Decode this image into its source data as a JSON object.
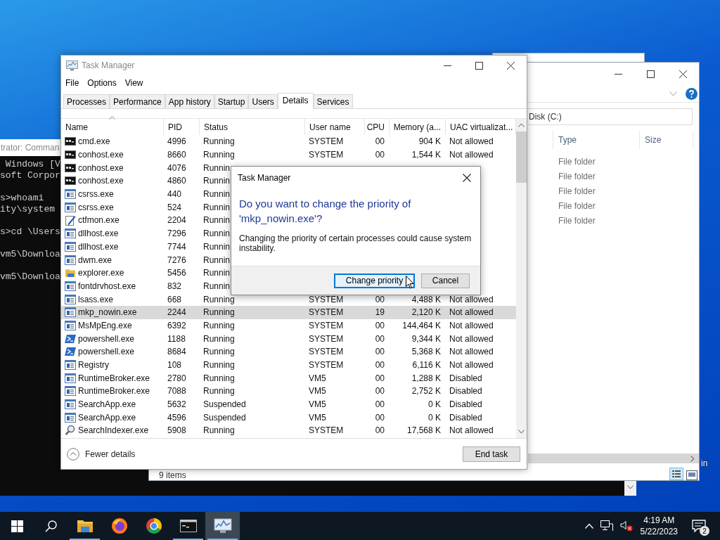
{
  "desktop": {
    "icon_labels": [
      "in"
    ]
  },
  "console_window": {
    "title": "trator: Comman",
    "blocks": [
      [
        " Windows [V",
        "soft Corpor"
      ],
      [
        "s>whoami",
        "ity\\system"
      ],
      [
        "s>cd \\Users"
      ],
      [
        "vm5\\Downloa"
      ],
      [
        "vm5\\Downloa"
      ]
    ]
  },
  "explorer_window": {
    "address": "Disk (C:)",
    "columns": [
      "Type",
      "Size"
    ],
    "rows": [
      {
        "type": "File folder"
      },
      {
        "type": "File folder"
      },
      {
        "type": "File folder"
      },
      {
        "type": "File folder"
      },
      {
        "type": "File folder"
      }
    ],
    "status": "9 items"
  },
  "task_manager": {
    "title": "Task Manager",
    "menu": [
      "File",
      "Options",
      "View"
    ],
    "tabs": [
      {
        "label": "Processes",
        "selected": false
      },
      {
        "label": "Performance",
        "selected": false
      },
      {
        "label": "App history",
        "selected": false
      },
      {
        "label": "Startup",
        "selected": false
      },
      {
        "label": "Users",
        "selected": false
      },
      {
        "label": "Details",
        "selected": true
      },
      {
        "label": "Services",
        "selected": false
      }
    ],
    "columns": [
      {
        "label": "Name",
        "sorted": true
      },
      {
        "label": "PID",
        "sorted": false
      },
      {
        "label": "Status",
        "sorted": false
      },
      {
        "label": "User name",
        "sorted": false
      },
      {
        "label": "CPU",
        "sorted": false
      },
      {
        "label": "Memory (a...",
        "sorted": false
      },
      {
        "label": "UAC virtualizat...",
        "sorted": false
      }
    ],
    "rows": [
      {
        "kind": "console",
        "name": "cmd.exe",
        "pid": "4996",
        "status": "Running",
        "user": "SYSTEM",
        "cpu": "00",
        "memory": "904 K",
        "uac": "Not allowed",
        "selected": false
      },
      {
        "kind": "console",
        "name": "conhost.exe",
        "pid": "8660",
        "status": "Running",
        "user": "SYSTEM",
        "cpu": "00",
        "memory": "1,544 K",
        "uac": "Not allowed",
        "selected": false
      },
      {
        "kind": "console",
        "name": "conhost.exe",
        "pid": "4076",
        "status": "Runnin",
        "selected": false
      },
      {
        "kind": "console",
        "name": "conhost.exe",
        "pid": "4860",
        "status": "Runnin",
        "selected": false
      },
      {
        "kind": "app",
        "name": "csrss.exe",
        "pid": "440",
        "status": "Runnin",
        "selected": false
      },
      {
        "kind": "app",
        "name": "csrss.exe",
        "pid": "524",
        "status": "Runnin",
        "selected": false
      },
      {
        "kind": "pen",
        "name": "ctfmon.exe",
        "pid": "2204",
        "status": "Runnin",
        "selected": false
      },
      {
        "kind": "app",
        "name": "dllhost.exe",
        "pid": "7296",
        "status": "Runnin",
        "selected": false
      },
      {
        "kind": "app",
        "name": "dllhost.exe",
        "pid": "7744",
        "status": "Runnin",
        "selected": false
      },
      {
        "kind": "app",
        "name": "dwm.exe",
        "pid": "7276",
        "status": "Runnin",
        "selected": false
      },
      {
        "kind": "folder",
        "name": "explorer.exe",
        "pid": "5456",
        "status": "Runnin",
        "selected": false
      },
      {
        "kind": "app",
        "name": "fontdrvhost.exe",
        "pid": "832",
        "status": "Runnin",
        "selected": false
      },
      {
        "kind": "app",
        "name": "lsass.exe",
        "pid": "668",
        "status": "Running",
        "user": "SYSTEM",
        "cpu": "00",
        "memory": "4,488 K",
        "uac": "Not allowed",
        "selected": false
      },
      {
        "kind": "app",
        "name": "mkp_nowin.exe",
        "pid": "2244",
        "status": "Running",
        "user": "SYSTEM",
        "cpu": "19",
        "memory": "2,120 K",
        "uac": "Not allowed",
        "selected": true
      },
      {
        "kind": "app",
        "name": "MsMpEng.exe",
        "pid": "6392",
        "status": "Running",
        "user": "SYSTEM",
        "cpu": "00",
        "memory": "144,464 K",
        "uac": "Not allowed",
        "selected": false
      },
      {
        "kind": "shell",
        "name": "powershell.exe",
        "pid": "1188",
        "status": "Running",
        "user": "SYSTEM",
        "cpu": "00",
        "memory": "9,344 K",
        "uac": "Not allowed",
        "selected": false
      },
      {
        "kind": "shell",
        "name": "powershell.exe",
        "pid": "8684",
        "status": "Running",
        "user": "SYSTEM",
        "cpu": "00",
        "memory": "5,368 K",
        "uac": "Not allowed",
        "selected": false
      },
      {
        "kind": "app",
        "name": "Registry",
        "pid": "108",
        "status": "Running",
        "user": "SYSTEM",
        "cpu": "00",
        "memory": "6,116 K",
        "uac": "Not allowed",
        "selected": false
      },
      {
        "kind": "app",
        "name": "RuntimeBroker.exe",
        "pid": "2780",
        "status": "Running",
        "user": "VM5",
        "cpu": "00",
        "memory": "1,288 K",
        "uac": "Disabled",
        "selected": false
      },
      {
        "kind": "app",
        "name": "RuntimeBroker.exe",
        "pid": "7088",
        "status": "Running",
        "user": "VM5",
        "cpu": "00",
        "memory": "2,752 K",
        "uac": "Disabled",
        "selected": false
      },
      {
        "kind": "app",
        "name": "SearchApp.exe",
        "pid": "5632",
        "status": "Suspended",
        "user": "VM5",
        "cpu": "00",
        "memory": "0 K",
        "uac": "Disabled",
        "selected": false
      },
      {
        "kind": "app",
        "name": "SearchApp.exe",
        "pid": "4596",
        "status": "Suspended",
        "user": "VM5",
        "cpu": "00",
        "memory": "0 K",
        "uac": "Disabled",
        "selected": false
      },
      {
        "kind": "magnifier",
        "name": "SearchIndexer.exe",
        "pid": "5908",
        "status": "Running",
        "user": "SYSTEM",
        "cpu": "00",
        "memory": "17,568 K",
        "uac": "Not allowed",
        "selected": false
      }
    ],
    "footer": {
      "details_link": "Fewer details",
      "end_task": "End task"
    }
  },
  "dialog": {
    "title": "Task Manager",
    "heading": "Do you want to change the priority of 'mkp_nowin.exe'?",
    "message": "Changing the priority of certain processes could cause system instability.",
    "buttons": [
      {
        "label": "Change priority",
        "focused": true
      },
      {
        "label": "Cancel",
        "focused": false
      }
    ]
  },
  "taskbar": {
    "apps": [
      {
        "kind": "folder",
        "running": true,
        "active": false
      },
      {
        "kind": "fox",
        "running": false,
        "active": false
      },
      {
        "kind": "ring",
        "running": false,
        "active": false
      },
      {
        "kind": "console",
        "running": true,
        "active": false
      },
      {
        "kind": "monitor",
        "running": true,
        "active": true
      }
    ],
    "time": "4:19 AM",
    "date": "5/22/2023",
    "notifications": "2"
  }
}
